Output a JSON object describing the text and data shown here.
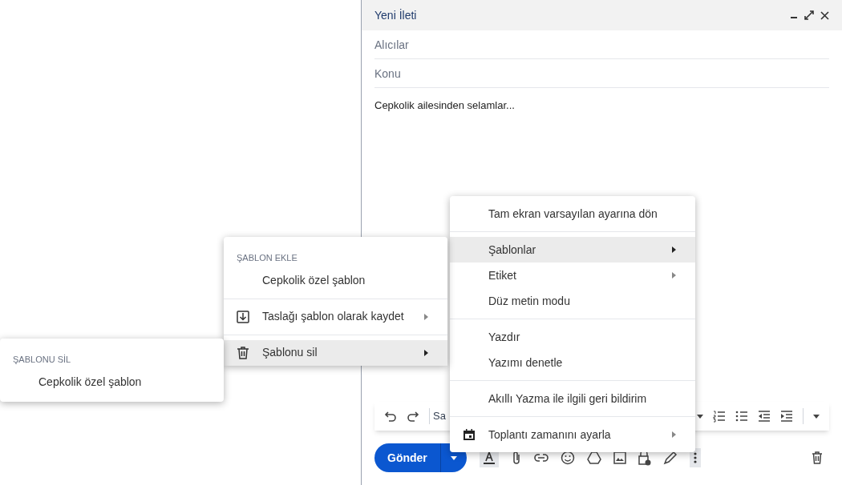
{
  "compose": {
    "title": "Yeni İleti",
    "to": {
      "placeholder": "Alıcılar"
    },
    "subject": {
      "placeholder": "Konu"
    },
    "body": "Cepkolik ailesinden selamlar...",
    "format_toolbar": {
      "font": "Sa"
    },
    "send_button": "Gönder"
  },
  "main_menu": {
    "sections": [
      [
        {
          "label": "Tam ekran varsayılan ayarına dön",
          "submenu": false,
          "selected": false
        }
      ],
      [
        {
          "label": "Şablonlar",
          "submenu": true,
          "selected": true
        },
        {
          "label": "Etiket",
          "submenu": true,
          "selected": false
        },
        {
          "label": "Düz metin modu",
          "submenu": false,
          "selected": false
        }
      ],
      [
        {
          "label": "Yazdır",
          "submenu": false,
          "selected": false
        },
        {
          "label": "Yazımı denetle",
          "submenu": false,
          "selected": false
        }
      ],
      [
        {
          "label": "Akıllı Yazma ile ilgili geri bildirim",
          "submenu": false,
          "selected": false
        }
      ],
      [
        {
          "label": "Toplantı zamanını ayarla",
          "kind": "calendar",
          "submenu": true,
          "selected": false
        }
      ]
    ]
  },
  "templates_menu": {
    "heading": "ŞABLON EKLE",
    "sections": [
      [
        {
          "label": "Cepkolik özel şablon",
          "submenu": false,
          "selected": false
        }
      ],
      [
        {
          "label": "Taslağı şablon olarak kaydet",
          "kind": "save",
          "submenu": true,
          "selected": false
        }
      ],
      [
        {
          "label": "Şablonu sil",
          "kind": "delete",
          "submenu": true,
          "selected": true
        }
      ]
    ]
  },
  "delete_menu": {
    "heading": "ŞABLONU SİL",
    "sections": [
      [
        {
          "label": "Cepkolik özel şablon",
          "submenu": false,
          "selected": false
        }
      ]
    ]
  }
}
